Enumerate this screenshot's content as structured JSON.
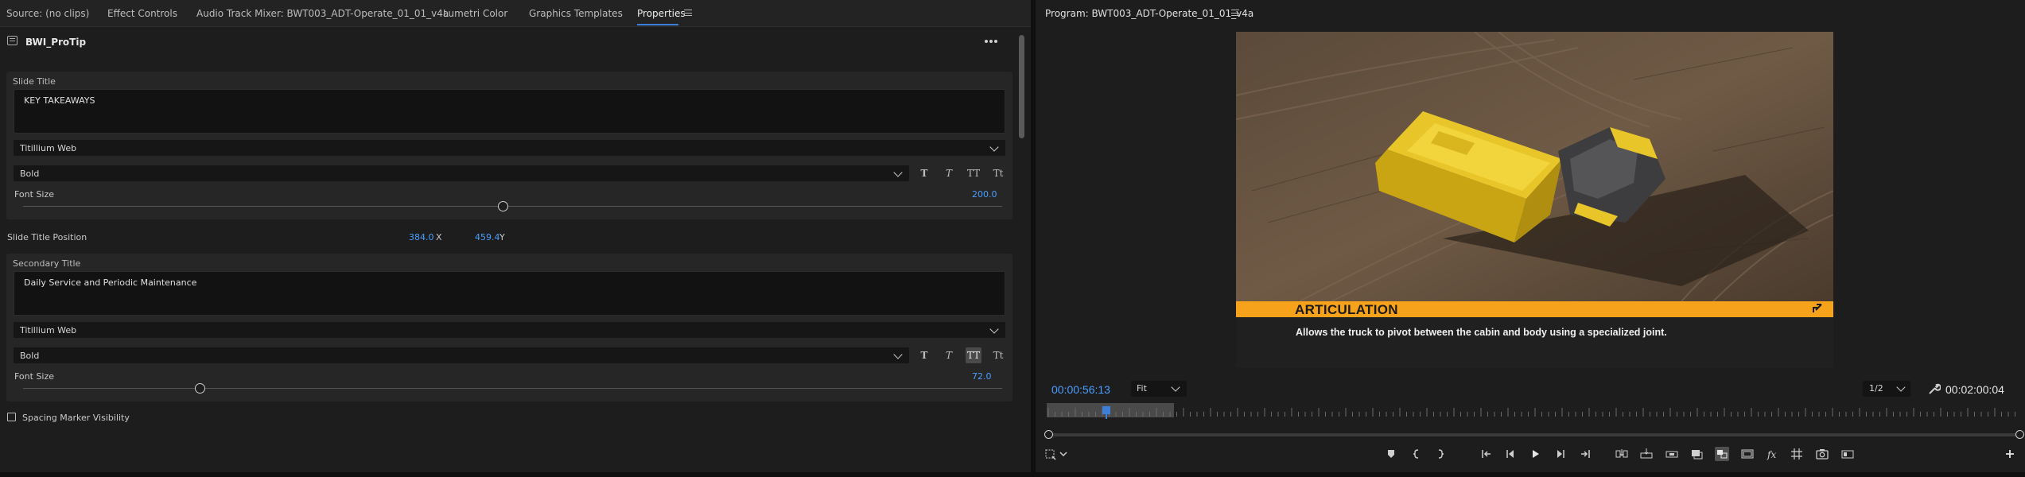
{
  "left_tabs": [
    "Source: (no clips)",
    "Effect Controls",
    "Audio Track Mixer: BWT003_ADT-Operate_01_01_v4a",
    "Lumetri Color",
    "Graphics Templates",
    "Properties"
  ],
  "properties": {
    "clip_name": "BWI_ProTip",
    "slide_title": {
      "section_label": "Slide Title",
      "text": "KEY TAKEAWAYS",
      "font": "Titillium Web",
      "weight": "Bold",
      "font_size_label": "Font Size",
      "font_size_value": "200.0",
      "font_size_level": 0.49,
      "style_buttons": [
        "T",
        "T",
        "TT",
        "Tt"
      ],
      "active_style": null
    },
    "position": {
      "label": "Slide Title Position",
      "x_value": "384.0",
      "x_label": "X",
      "y_value": "459.4",
      "y_label": "Y"
    },
    "secondary_title": {
      "section_label": "Secondary Title",
      "text": "Daily Service and Periodic Maintenance",
      "font": "Titillium Web",
      "weight": "Bold",
      "font_size_label": "Font Size",
      "font_size_value": "72.0",
      "font_size_level": 0.18,
      "style_buttons": [
        "T",
        "T",
        "TT",
        "Tt"
      ],
      "active_style": 2
    },
    "spacing_marker_label": "Spacing Marker Visibility"
  },
  "program": {
    "title": "Program: BWT003_ADT-Operate_01_01_v4a",
    "lower_third_title": "ARTICULATION",
    "lower_third_caption": "Allows the truck to pivot between the cabin and body using a specialized joint.",
    "current_timecode": "00:00:56:13",
    "zoom": "Fit",
    "resolution": "1/2",
    "duration": "00:02:00:04"
  },
  "colors": {
    "accent_blue": "#4b9eff",
    "lower_third_orange": "#f7a21b",
    "panel_bg": "#1d1d1d"
  },
  "icons": {
    "transport": [
      "marker-icon",
      "mark-in-icon",
      "mark-out-icon",
      "go-to-in-icon",
      "step-back-icon",
      "play-icon",
      "step-forward-icon",
      "go-to-out-icon",
      "insert-icon",
      "overwrite-icon",
      "lift-icon",
      "extract-icon",
      "comparison-view-icon",
      "proxy-toggle-icon",
      "fx-icon",
      "safe-margins-icon",
      "export-frame-icon",
      "vr-video-icon",
      "add-button-icon"
    ]
  }
}
